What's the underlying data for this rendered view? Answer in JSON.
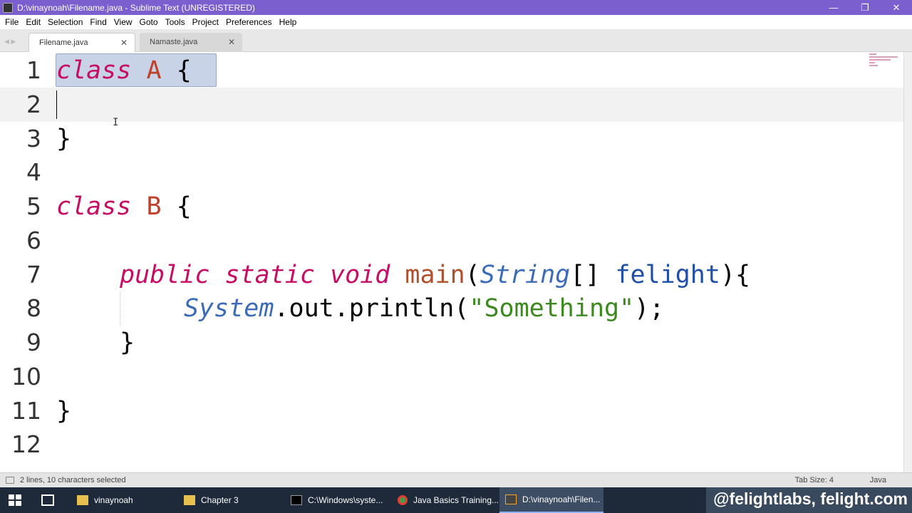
{
  "window": {
    "title": "D:\\vinaynoah\\Filename.java - Sublime Text (UNREGISTERED)",
    "controls": {
      "minimize": "—",
      "restore": "❐",
      "close": "✕"
    }
  },
  "menu": [
    "File",
    "Edit",
    "Selection",
    "Find",
    "View",
    "Goto",
    "Tools",
    "Project",
    "Preferences",
    "Help"
  ],
  "tabs": [
    {
      "label": "Filename.java",
      "active": true
    },
    {
      "label": "Namaste.java",
      "active": false
    }
  ],
  "editor": {
    "line_numbers": [
      "1",
      "2",
      "3",
      "4",
      "5",
      "6",
      "7",
      "8",
      "9",
      "10",
      "11",
      "12"
    ],
    "lines": {
      "l1": {
        "kw": "class",
        "name": "A",
        "rest": "{"
      },
      "l3": {
        "text": "}"
      },
      "l5": {
        "kw": "class",
        "name": "B",
        "rest": "{"
      },
      "l7": {
        "mod1": "public",
        "mod2": "static",
        "mod3": "void",
        "fn": "main",
        "p1": "(",
        "type": "String",
        "p2": "[] ",
        "param": "felight",
        "p3": "){"
      },
      "l8": {
        "type": "System",
        "p1": ".out.println(",
        "str": "\"Something\"",
        "p2": ");"
      },
      "l9": {
        "text": "}"
      },
      "l11": {
        "text": "}"
      }
    },
    "selection_colors": {
      "fill": "#c8d3e8",
      "border": "#98a8c8"
    }
  },
  "status": {
    "selection": "2 lines, 10 characters selected",
    "tab_size": "Tab Size: 4",
    "syntax": "Java"
  },
  "taskbar": {
    "items": [
      {
        "label": "vinaynoah",
        "icon": "folder-icon"
      },
      {
        "label": "Chapter 3",
        "icon": "folder-icon"
      },
      {
        "label": "C:\\Windows\\syste...",
        "icon": "cmd-icon"
      },
      {
        "label": "Java Basics Training...",
        "icon": "chrome-icon"
      },
      {
        "label": "D:\\vinaynoah\\Filen...",
        "icon": "sublime-icon"
      }
    ],
    "watermark": "@felightlabs, felight.com"
  },
  "colors": {
    "titlebar": "#7b5fcf",
    "keyword": "#c70e65",
    "string": "#3c8a1f",
    "identifier": "#1f4fa6"
  }
}
